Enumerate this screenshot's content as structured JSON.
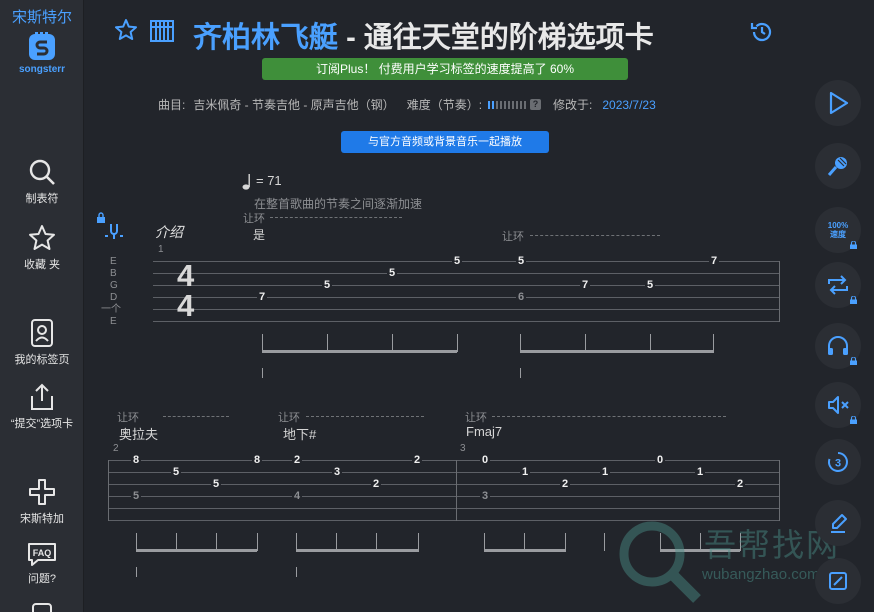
{
  "brand": {
    "name": "宋斯特尔",
    "wordmark": "songsterr"
  },
  "sidebar": {
    "items": [
      {
        "label": "制表符",
        "icon": "search-icon"
      },
      {
        "label": "收藏 夹",
        "icon": "star-icon"
      },
      {
        "label": "我的标签页",
        "icon": "user-icon"
      },
      {
        "label": "“提交”选项卡",
        "icon": "upload-icon"
      },
      {
        "label": "宋斯特加",
        "icon": "plus-icon"
      },
      {
        "label": "问题?",
        "icon": "faq-icon"
      }
    ],
    "faq_text": "FAQ"
  },
  "header": {
    "artist": "齐柏林飞艇",
    "separator": " - ",
    "song": "通往天堂的阶梯选项卡",
    "promo": "订阅Plus！ 付费用户学习标签的速度提高了 60%",
    "meta": {
      "track_label": "曲目:",
      "track_value": "吉米佩奇 - 节奏吉他 - 原声吉他（钢）",
      "difficulty_label": "难度（节奏）:",
      "difficulty_level": 0.2,
      "difficulty_help": "?",
      "modified_label": "修改于:",
      "modified_date": "2023/7/23"
    },
    "play_along": "与官方音频或背景音乐一起播放"
  },
  "rightbar": {
    "speed_value": "100%",
    "speed_label": "速度"
  },
  "tab": {
    "tempo": "= 71",
    "tempo_note": "在整首歌曲的节奏之间逐渐加速",
    "let_ring": "让环",
    "section": "介绍",
    "lyric1": "是",
    "tuning": [
      "E",
      "B",
      "G",
      "D",
      "一个",
      "E"
    ],
    "time_sig_top": "4",
    "time_sig_bottom": "4",
    "measure1_num": "1",
    "measure2_num": "2",
    "measure3_num": "3",
    "chord_a": "奥拉夫",
    "chord_b": "地下#",
    "chord_c": "Fmaj7",
    "row1_notes": [
      "7",
      "5",
      "5",
      "5",
      "7",
      "5",
      "6",
      "5",
      "7"
    ],
    "row2_notes": [
      "8",
      "5",
      "5",
      "5",
      "8",
      "2",
      "3",
      "4",
      "2",
      "2",
      "0",
      "1",
      "2",
      "3",
      "1",
      "0",
      "1",
      "2"
    ]
  },
  "watermark": {
    "text": "吾帮找网",
    "url": "wubangzhao.com"
  },
  "colors": {
    "accent": "#4aa0ff",
    "promo": "#3f8f3a",
    "play": "#1f7ae8",
    "bg": "#22252b"
  }
}
